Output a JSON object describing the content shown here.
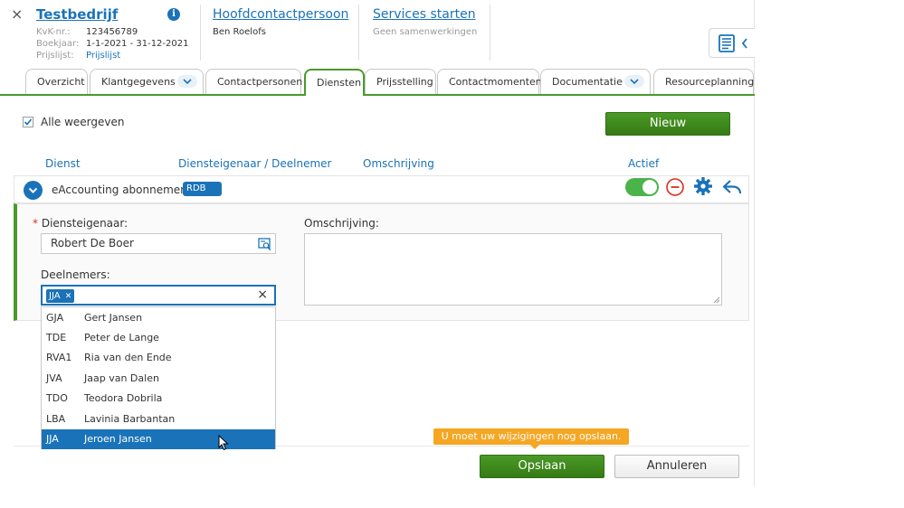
{
  "header": {
    "close_glyph": "×",
    "company_name": "Testbedrijf",
    "info_glyph": "i",
    "kvk_label": "KvK-nr.:",
    "kvk_value": "123456789",
    "boekjaar_label": "Boekjaar:",
    "boekjaar_value": "1-1-2021 - 31-12-2021",
    "prijslijst_label": "Prijslijst:",
    "prijslijst_value": "Prijslijst",
    "contact_link": "Hoofdcontactpersoon",
    "contact_name": "Ben Roelofs",
    "services_link": "Services starten",
    "services_sub": "Geen samenwerkingen"
  },
  "tabs": [
    {
      "label": "Overzicht"
    },
    {
      "label": "Klantgegevens"
    },
    {
      "label": "Contactpersonen"
    },
    {
      "label": "Diensten"
    },
    {
      "label": "Prijsstelling"
    },
    {
      "label": "Contactmomenten"
    },
    {
      "label": "Documentatie"
    },
    {
      "label": "Resourceplanning"
    }
  ],
  "active_tab": "Diensten",
  "controls": {
    "show_all_label": "Alle weergeven",
    "new_button": "Nieuw"
  },
  "columns": {
    "dienst": "Dienst",
    "eigenaar": "Diensteigenaar / Deelnemer",
    "omschrijving": "Omschrijving",
    "actief": "Actief"
  },
  "service": {
    "name": "eAccounting abonnement",
    "badge": "RDB",
    "active": true
  },
  "form": {
    "required_mark": "*",
    "owner_label": "Diensteigenaar:",
    "owner_value": "Robert De Boer",
    "description_label": "Omschrijving:",
    "participants_label": "Deelnemers:",
    "tag": "JJA",
    "tag_remove": "✕",
    "clear_glyph": "×"
  },
  "dropdown": {
    "items": [
      {
        "code": "GJA",
        "name": "Gert Jansen"
      },
      {
        "code": "TDE",
        "name": "Peter de Lange"
      },
      {
        "code": "RVA1",
        "name": "Ria van den Ende"
      },
      {
        "code": "JVA",
        "name": "Jaap van Dalen"
      },
      {
        "code": "TDO",
        "name": "Teodora Dobrila"
      },
      {
        "code": "LBA",
        "name": "Lavinia Barbantan"
      },
      {
        "code": "JJA",
        "name": "Jeroen Jansen"
      }
    ],
    "selected_code": "JJA"
  },
  "footer": {
    "notice": "U moet uw wijzigingen nog opslaan.",
    "save": "Opslaan",
    "cancel": "Annuleren"
  },
  "colors": {
    "accent": "#1a73b8",
    "brand_green": "#4a9a2a",
    "toggle_on": "#4ab34a",
    "remove_red": "#d9301e",
    "notice": "#f5a623"
  }
}
